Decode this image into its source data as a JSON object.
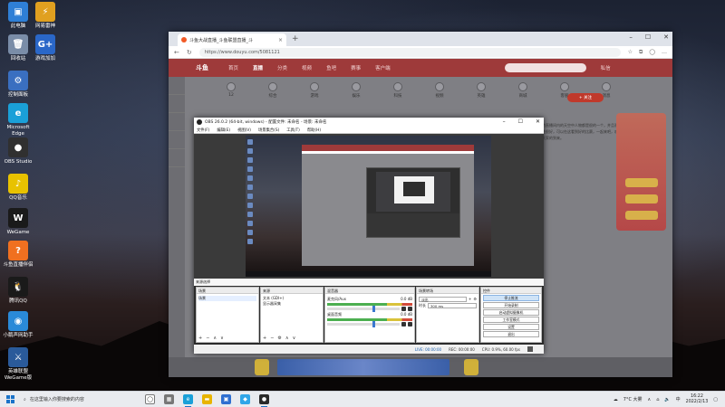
{
  "desktop": {
    "icons": [
      {
        "label": "此电脑",
        "color": "#2f7fd6",
        "glyph": "▣"
      },
      {
        "label": "网易雷神",
        "color": "#e0a020",
        "glyph": "⚡"
      },
      {
        "label": "回收站",
        "color": "#7a8da8",
        "glyph": "🗑"
      },
      {
        "label": "游戏加加",
        "color": "#2a67c8",
        "glyph": "G+"
      },
      {
        "label": "控制面板",
        "color": "#3a6fc0",
        "glyph": "⚙"
      },
      {
        "label": "Microsoft Edge",
        "color": "#1aa0d8",
        "glyph": "e"
      },
      {
        "label": "OBS Studio",
        "color": "#303030",
        "glyph": "●"
      },
      {
        "label": "QQ音乐",
        "color": "#e8c200",
        "glyph": "♪"
      },
      {
        "label": "WeGame",
        "color": "#1a1a1a",
        "glyph": "W"
      },
      {
        "label": "斗鱼直播伴侣",
        "color": "#f07020",
        "glyph": "?"
      },
      {
        "label": "腾讯QQ",
        "color": "#1a1a1a",
        "glyph": "🐧"
      },
      {
        "label": "小鹅声网助手",
        "color": "#2a8ad8",
        "glyph": "◉"
      },
      {
        "label": "英雄联盟WeGame版",
        "color": "#2a5a9a",
        "glyph": "⚔"
      }
    ]
  },
  "browser": {
    "tab_title": "斗鱼大战直播_斗鱼联盟直播_斗",
    "url": "https://www.douyu.com/5081121",
    "site_nav": [
      "首页",
      "直播",
      "分类",
      "视频",
      "鱼吧",
      "赛事",
      "客户端",
      "私信"
    ],
    "site_logo": "斗鱼",
    "categories": [
      "12",
      "综合",
      "游戏",
      "娱乐",
      "科技",
      "视频",
      "英雄",
      "商城",
      "客服",
      "消息"
    ],
    "follow_label": "+ 关注",
    "right_text": "的直播间内的天空中人物都是很的一个，并且观赏性很好，可以在这看到好的比赛，一起来吧，欢迎大家的到来。"
  },
  "obs": {
    "title": "OBS 26.0.2 (64-bit, windows) - 配置文件: 未命名 - 场景: 未命名",
    "menu": [
      "文件(F)",
      "编辑(E)",
      "视图(V)",
      "场景集合(S)",
      "工具(T)",
      "帮助(H)"
    ],
    "dock_header": "来源选择",
    "scenes": {
      "title": "场景",
      "items": [
        "场景"
      ]
    },
    "sources": {
      "title": "来源",
      "items": [
        "文本 (GDI+)",
        "显示器采集"
      ]
    },
    "mixer": {
      "title": "混音器",
      "channels": [
        {
          "name": "麦克风/Aux",
          "db": "0.0 dB"
        },
        {
          "name": "桌面音频",
          "db": "0.0 dB"
        }
      ]
    },
    "transitions": {
      "title": "场景转场",
      "type": "淡出",
      "duration_label": "时长",
      "duration": "300 ms"
    },
    "controls": {
      "title": "控件",
      "buttons": [
        "停止推流",
        "开始录制",
        "启动虚拟摄像机",
        "工作室模式",
        "设置",
        "退出"
      ]
    },
    "status": {
      "live": "LIVE: 00:00:00",
      "rec": "REC: 00:00:00",
      "cpu": "CPU: 0.9%, 60.00 fps"
    }
  },
  "taskbar": {
    "search_placeholder": "在这里输入你要搜索的内容",
    "weather": "7°C 大雾",
    "ime": "中",
    "time": "16:22",
    "date": "2022/2/13"
  }
}
